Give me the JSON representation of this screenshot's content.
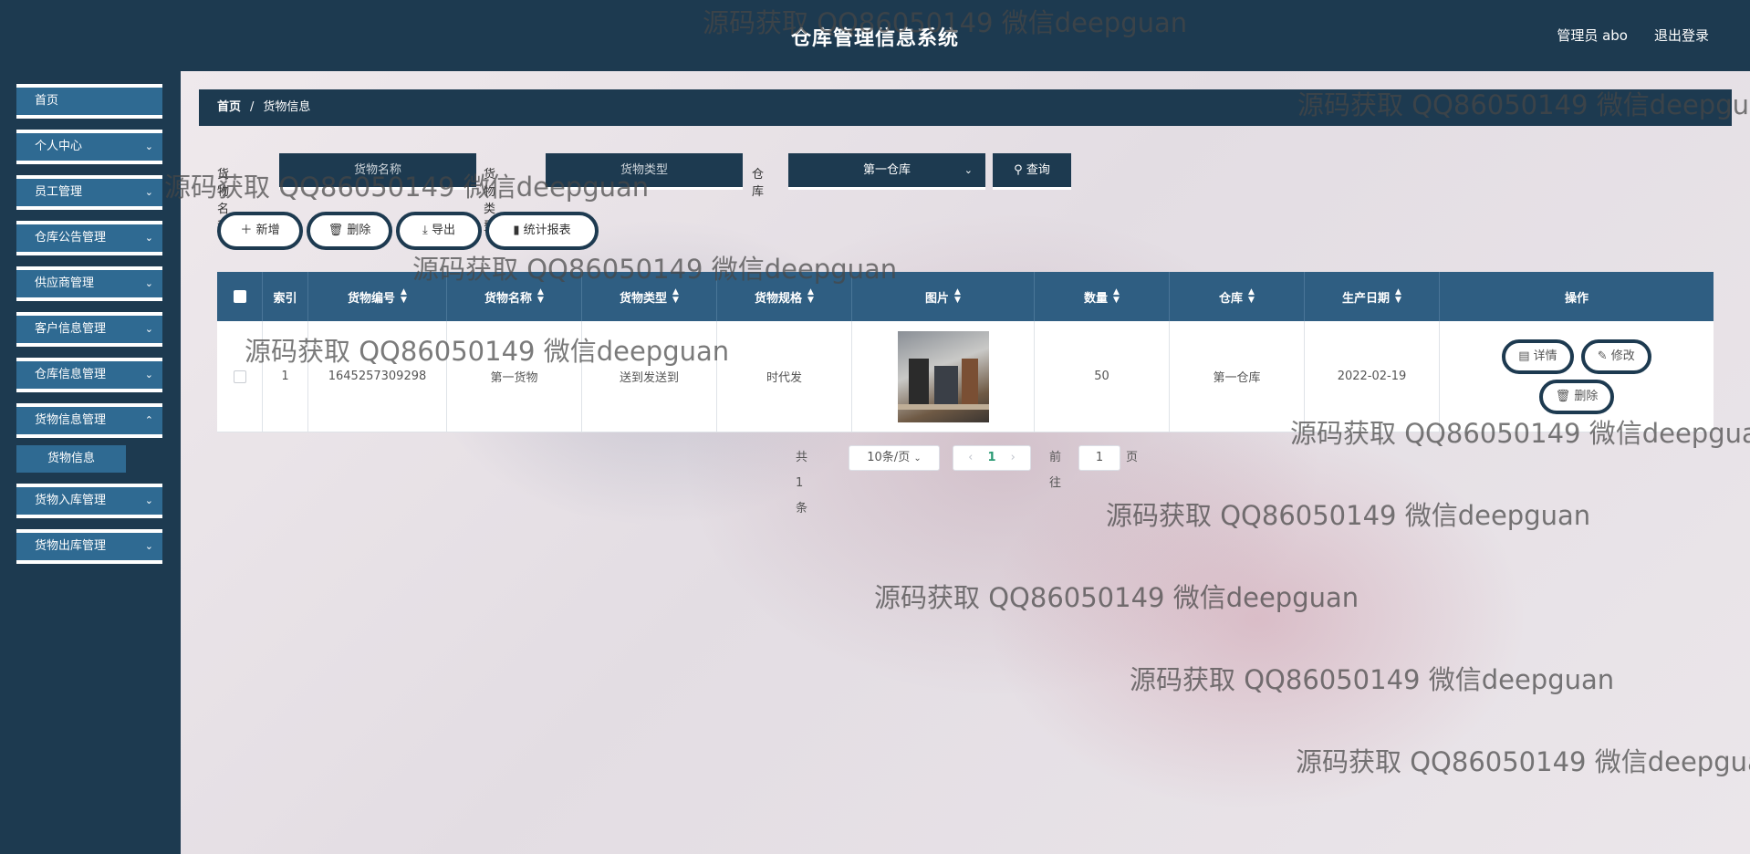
{
  "header": {
    "title": "仓库管理信息系统",
    "user": "管理员 abo",
    "logout": "退出登录"
  },
  "sidebar": {
    "items": [
      {
        "label": "首页"
      },
      {
        "label": "个人中心"
      },
      {
        "label": "员工管理"
      },
      {
        "label": "仓库公告管理"
      },
      {
        "label": "供应商管理"
      },
      {
        "label": "客户信息管理"
      },
      {
        "label": "仓库信息管理"
      },
      {
        "label": "货物信息管理"
      },
      {
        "label": "货物入库管理"
      },
      {
        "label": "货物出库管理"
      }
    ],
    "sub_item": "货物信息"
  },
  "breadcrumb": {
    "home": "首页",
    "sep": "/",
    "current": "货物信息"
  },
  "search": {
    "name_label": "货物名称",
    "name_placeholder": "货物名称",
    "type_label": "货物类型",
    "type_placeholder": "货物类型",
    "warehouse_label": "仓库",
    "warehouse_value": "第一仓库",
    "query": "查询"
  },
  "actions": {
    "add": "新增",
    "delete": "删除",
    "export": "导出",
    "report": "统计报表"
  },
  "table": {
    "columns": [
      "索引",
      "货物编号",
      "货物名称",
      "货物类型",
      "货物规格",
      "图片",
      "数量",
      "仓库",
      "生产日期",
      "操作"
    ],
    "rows": [
      {
        "index": "1",
        "code": "1645257309298",
        "name": "第一货物",
        "type": "送到发送到",
        "spec": "时代发",
        "quantity": "50",
        "warehouse": "第一仓库",
        "date": "2022-02-19"
      }
    ],
    "op_detail": "详情",
    "op_edit": "修改",
    "op_delete": "删除"
  },
  "pager": {
    "total": "共 1 条",
    "page_size": "10条/页",
    "current": "1",
    "goto": "前往",
    "goto_value": "1",
    "page_unit": "页"
  },
  "watermark": "源码获取 QQ86050149 微信deepguan"
}
